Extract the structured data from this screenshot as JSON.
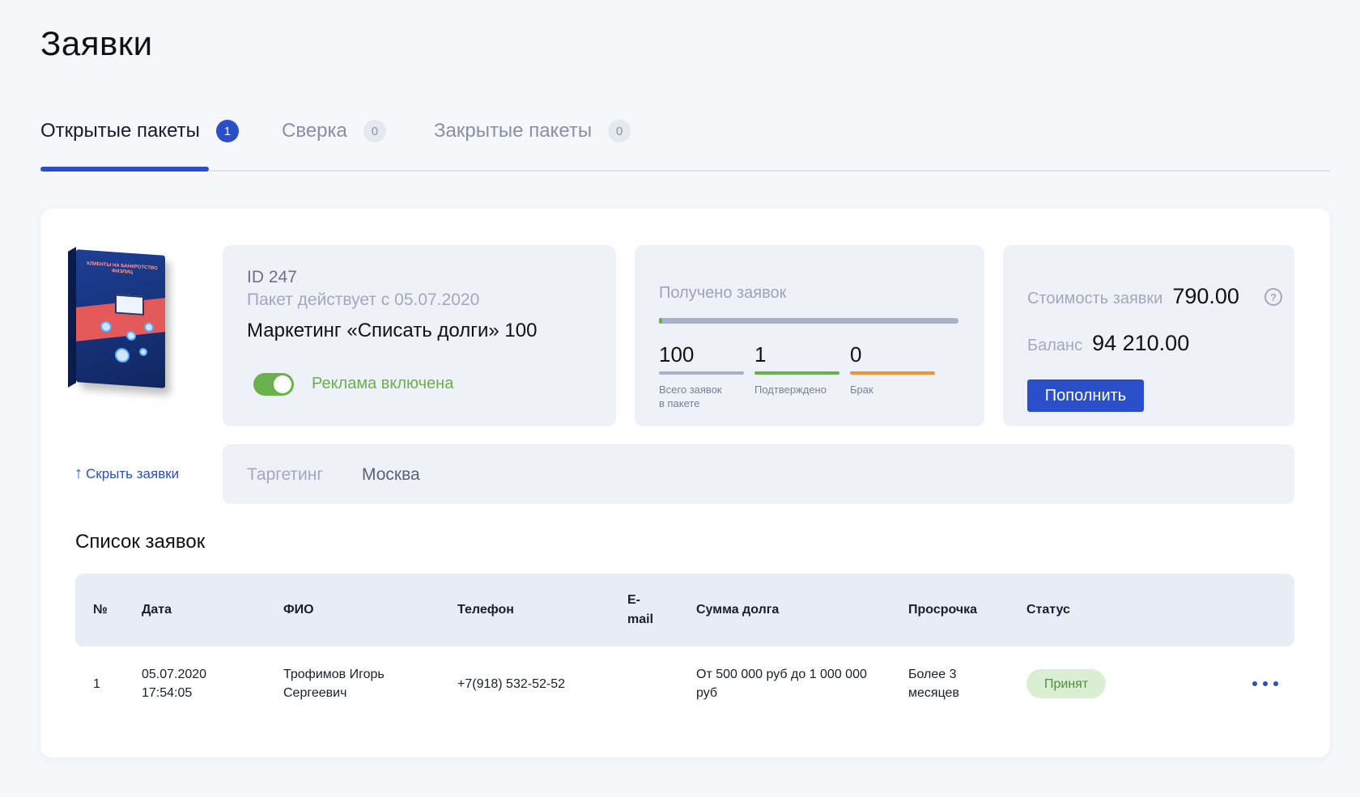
{
  "page": {
    "title": "Заявки"
  },
  "tabs": [
    {
      "label": "Открытые пакеты",
      "count": "1",
      "active": true
    },
    {
      "label": "Сверка",
      "count": "0",
      "active": false
    },
    {
      "label": "Закрытые пакеты",
      "count": "0",
      "active": false
    }
  ],
  "package": {
    "box_text": "КЛИЕНТЫ НА БАНКРОТСТВО ФИЗЛИЦ",
    "id_label": "ID 247",
    "active_since": "Пакет действует с 05.07.2020",
    "name": "Маркетинг «Списать долги» 100",
    "ads_label": "Реклама включена",
    "ads_enabled": true
  },
  "stats": {
    "title": "Получено заявок",
    "progress_fraction": 0.01,
    "items": [
      {
        "value": "100",
        "caption": "Всего заявок\nв пакете",
        "color": "#a9b0c8"
      },
      {
        "value": "1",
        "caption": "Подтверждено",
        "color": "#6ab04c"
      },
      {
        "value": "0",
        "caption": "Брак",
        "color": "#f0923a"
      }
    ]
  },
  "pricing": {
    "price_label": "Стоимость заявки",
    "price_value": "790.00",
    "balance_label": "Баланс",
    "balance_value": "94 210.00",
    "topup_label": "Пополнить",
    "help_icon": "question-circle-icon"
  },
  "hide_link": {
    "label": "Скрыть заявки",
    "icon": "arrow-up-icon"
  },
  "targeting": {
    "label": "Таргетинг",
    "value": "Москва"
  },
  "list": {
    "title": "Список заявок",
    "columns": [
      "№",
      "Дата",
      "ФИО",
      "Телефон",
      "E-\nmail",
      "Сумма долга",
      "Просрочка",
      "Статус"
    ],
    "rows": [
      {
        "num": "1",
        "date": "05.07.2020\n17:54:05",
        "name": "Трофимов Игорь\nСергеевич",
        "phone": "+7(918) 532-52-52",
        "email": "",
        "debt": "От 500 000 руб до 1 000 000\nруб",
        "overdue": "Более 3\nмесяцев",
        "status": "Принят"
      }
    ]
  },
  "colors": {
    "accent": "#2a4fc9",
    "success": "#6ab04c",
    "warning": "#f0923a"
  }
}
